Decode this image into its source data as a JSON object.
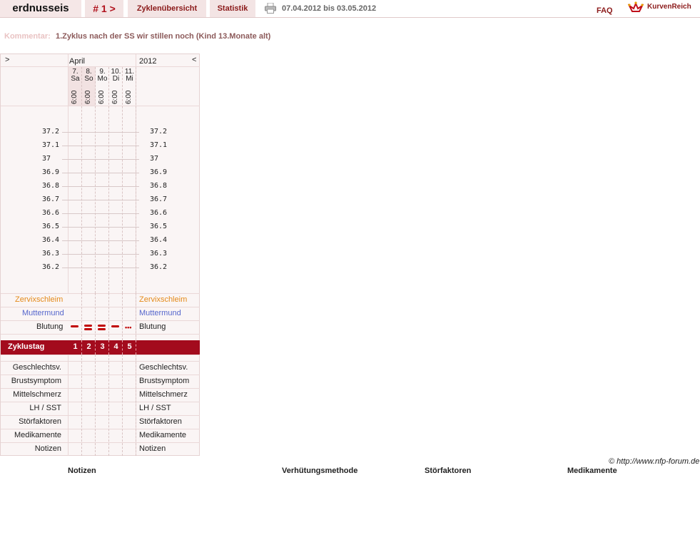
{
  "header": {
    "username": "erdnusseis",
    "cycle_label": "# 1 >",
    "overview_label": "Zyklenübersicht",
    "stats_label": "Statistik",
    "date_range": "07.04.2012 bis 03.05.2012",
    "faq_label": "FAQ",
    "brand": "KurvenReich"
  },
  "comment": {
    "label": "Kommentar:",
    "text": "1.Zyklus nach der SS wir stillen noch (Kind 13.Monate alt)"
  },
  "chart_nav": {
    "prev": ">",
    "month": "April",
    "year": "2012",
    "next": "<"
  },
  "days": [
    {
      "date": "7.",
      "weekday": "Sa",
      "time": "6:00"
    },
    {
      "date": "8.",
      "weekday": "So",
      "time": "6:00"
    },
    {
      "date": "9.",
      "weekday": "Mo",
      "time": "6:00"
    },
    {
      "date": "10.",
      "weekday": "Di",
      "time": "6:00"
    },
    {
      "date": "11.",
      "weekday": "Mi",
      "time": "6:00"
    }
  ],
  "temperatures": [
    "37.2",
    "37.1",
    "37",
    "36.9",
    "36.8",
    "36.7",
    "36.6",
    "36.5",
    "36.4",
    "36.3",
    "36.2"
  ],
  "rows_top": [
    "Zervixschleim",
    "Muttermund",
    "Blutung"
  ],
  "cycle_day": {
    "label": "Zyklustag",
    "values": [
      "1",
      "2",
      "3",
      "4",
      "5"
    ]
  },
  "rows_bottom": [
    "Geschlechtsv.",
    "Brustsymptom",
    "Mittelschmerz",
    "LH / SST",
    "Störfaktoren",
    "Medikamente",
    "Notizen"
  ],
  "bleeding": [
    "medium",
    "heavy",
    "heavy",
    "medium",
    "spotting"
  ],
  "colors": {
    "accent": "#a30b1d",
    "zervix": "#e48a1a",
    "muttermund": "#5566cc",
    "bleeding": "#c00000"
  },
  "footer": {
    "credit": "© http://www.nfp-forum.de",
    "notes_heading": "Notizen",
    "contraception_heading": "Verhütungsmethode",
    "disturbances_heading": "Störfaktoren",
    "medication_heading": "Medikamente"
  }
}
